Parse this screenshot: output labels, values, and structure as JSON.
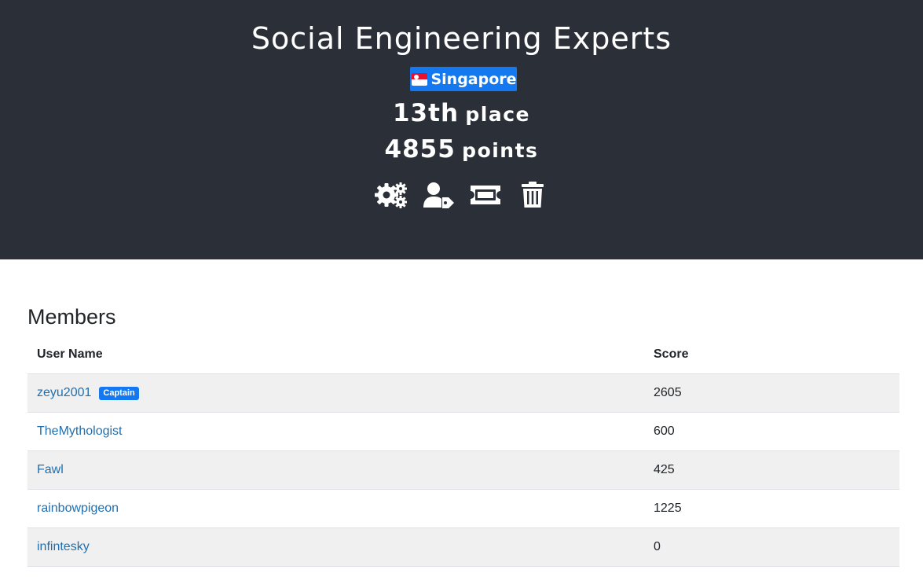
{
  "team": {
    "name": "Social Engineering Experts",
    "country": "Singapore",
    "place_num": "13th",
    "place_word": "place",
    "points_num": "4855",
    "points_word": "points"
  },
  "actions": [
    {
      "icon": "gears-icon",
      "label": "settings"
    },
    {
      "icon": "user-tag-icon",
      "label": "captain"
    },
    {
      "icon": "ticket-icon",
      "label": "invite"
    },
    {
      "icon": "trash-icon",
      "label": "delete"
    }
  ],
  "members": {
    "title": "Members",
    "columns": [
      "User Name",
      "Score"
    ],
    "rows": [
      {
        "name": "zeyu2001",
        "badge": "Captain",
        "score": "2605"
      },
      {
        "name": "TheMythologist",
        "badge": "",
        "score": "600"
      },
      {
        "name": "Fawl",
        "badge": "",
        "score": "425"
      },
      {
        "name": "rainbowpigeon",
        "badge": "",
        "score": "1225"
      },
      {
        "name": "infintesky",
        "badge": "",
        "score": "0"
      }
    ]
  },
  "colors": {
    "header_bg": "#2b3038",
    "badge_blue": "#1478f0",
    "link": "#1f6fb0",
    "stripe": "#f0f0f0"
  }
}
